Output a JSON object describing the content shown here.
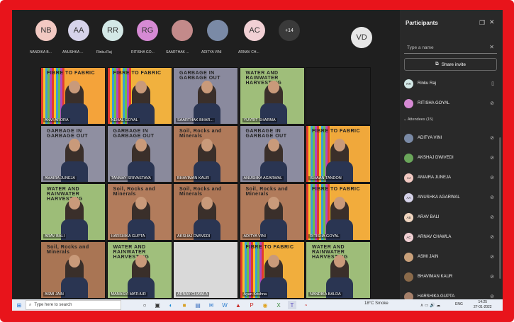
{
  "top_participants": [
    {
      "initials": "NB",
      "name": "NANDIKA B...",
      "color": "#f2c9c2"
    },
    {
      "initials": "AA",
      "name": "ANUSHKA ...",
      "color": "#d6d3ea"
    },
    {
      "initials": "RR",
      "name": "Rinku Raj",
      "color": "#d3e8e6"
    },
    {
      "initials": "RG",
      "name": "RITISHA GO...",
      "color": "#d68ad4"
    },
    {
      "initials": "",
      "name": "SAARTHAK ...",
      "color": "#c38a8a"
    },
    {
      "initials": "",
      "name": "ADITYA VINI",
      "color": "#7a8aa6"
    },
    {
      "initials": "AC",
      "name": "ARNAV CH...",
      "color": "#f1d0d4"
    }
  ],
  "overflow_count": "+14",
  "self_avatar": "VD",
  "tiles": [
    {
      "label": "ANVI ARORA",
      "poster": "FIBRE TO FABRIC",
      "bg": "#f4a33a"
    },
    {
      "label": "NEHAL GOYAL",
      "poster": "FIBRE TO FABRIC",
      "bg": "#f1b13e"
    },
    {
      "label": "SAARTHAK BHAR...",
      "poster": "GARBAGE IN GARBAGE OUT",
      "bg": "#8a8a9e"
    },
    {
      "label": "YUVRIT SHARMA",
      "poster": "WATER AND RAINWATER HARVESTING",
      "bg": "#9fbe7a"
    },
    {
      "label": "",
      "poster": "",
      "bg": "#1f1f1f"
    },
    {
      "label": "AMAIRA JUNEJA",
      "poster": "GARBAGE IN GARBAGE OUT",
      "bg": "#8f8fa1"
    },
    {
      "label": "TANMAY SRIVASTAVA",
      "poster": "GARBAGE IN GARBAGE OUT",
      "bg": "#8a8a9c"
    },
    {
      "label": "BHAVIMAN KAUR",
      "poster": "Soil, Rocks and Minerals",
      "bg": "#b07a5a"
    },
    {
      "label": "ANUSHKA AGARWAL",
      "poster": "GARBAGE IN GARBAGE OUT",
      "bg": "#8c8ca0"
    },
    {
      "label": "ISHAAN TANDON",
      "poster": "FIBRE TO FABRIC",
      "bg": "#f0a83b"
    },
    {
      "label": "ARAV BALI",
      "poster": "WATER AND RAINWATER HARVESTING",
      "bg": "#9dbd78"
    },
    {
      "label": "HARSHIKA GUPTA",
      "poster": "Soil, Rocks and Minerals",
      "bg": "#b27c5c"
    },
    {
      "label": "AKSHAJ DWIVEDI",
      "poster": "Soil, Rocks and Minerals",
      "bg": "#ad7656"
    },
    {
      "label": "ADITYA VINI",
      "poster": "Soil, Rocks and Minerals",
      "bg": "#b17b5b"
    },
    {
      "label": "RITISHA GOYAL",
      "poster": "FIBRE TO FABRIC",
      "bg": "#f2ac3c"
    },
    {
      "label": "ASMI JAIN",
      "poster": "Soil, Rocks and Minerals",
      "bg": "#a97554"
    },
    {
      "label": "MANASVI MATHUR",
      "poster": "WATER AND RAINWATER HARVESTING",
      "bg": "#a0bf7c"
    },
    {
      "label": "ARNAV CHAWLA",
      "poster": "",
      "bg": "#d9d9d9"
    },
    {
      "label": "Ayan Krishna",
      "poster": "FIBRE TO FABRIC",
      "bg": "#f1ae3d"
    },
    {
      "label": "NANDIKA BALDA",
      "poster": "WATER AND RAINWATER HARVESTING",
      "bg": "#9ebd79"
    }
  ],
  "panel": {
    "title": "Participants",
    "search_placeholder": "Type a name",
    "invite_label": "Share invite",
    "attendees_label": "Attendees (15)",
    "presenters": [
      {
        "name": "Rinku Raj",
        "initials": "RR",
        "color": "#d3e8e6",
        "mic": "on"
      },
      {
        "name": "RITISHA GOYAL",
        "initials": "",
        "color": "#d68ad4",
        "mic": "off"
      }
    ],
    "attendees": [
      {
        "name": "ADITYA VINI",
        "initials": "",
        "color": "#7a8aa6"
      },
      {
        "name": "AKSHAJ DWIVEDI",
        "initials": "",
        "color": "#6aa65a"
      },
      {
        "name": "AMAIRA JUNEJA",
        "initials": "AJ",
        "color": "#f2c9c2"
      },
      {
        "name": "ANUSHKA AGARWAL",
        "initials": "AA",
        "color": "#d6d3ea"
      },
      {
        "name": "ARAV BALI",
        "initials": "AB",
        "color": "#f1d6c0"
      },
      {
        "name": "ARNAV CHAWLA",
        "initials": "AC",
        "color": "#f1d0d4"
      },
      {
        "name": "ASMI JAIN",
        "initials": "",
        "color": "#c9a07a"
      },
      {
        "name": "BHAVIMAN KAUR",
        "initials": "",
        "color": "#8a6a4a"
      },
      {
        "name": "HARSHIKA GUPTA",
        "initials": "",
        "color": "#a6806a"
      }
    ]
  },
  "taskbar": {
    "search_placeholder": "Type here to search",
    "weather": "18°C Smoke",
    "lang": "ENG",
    "time": "14:25",
    "date": "27-01-2022"
  }
}
